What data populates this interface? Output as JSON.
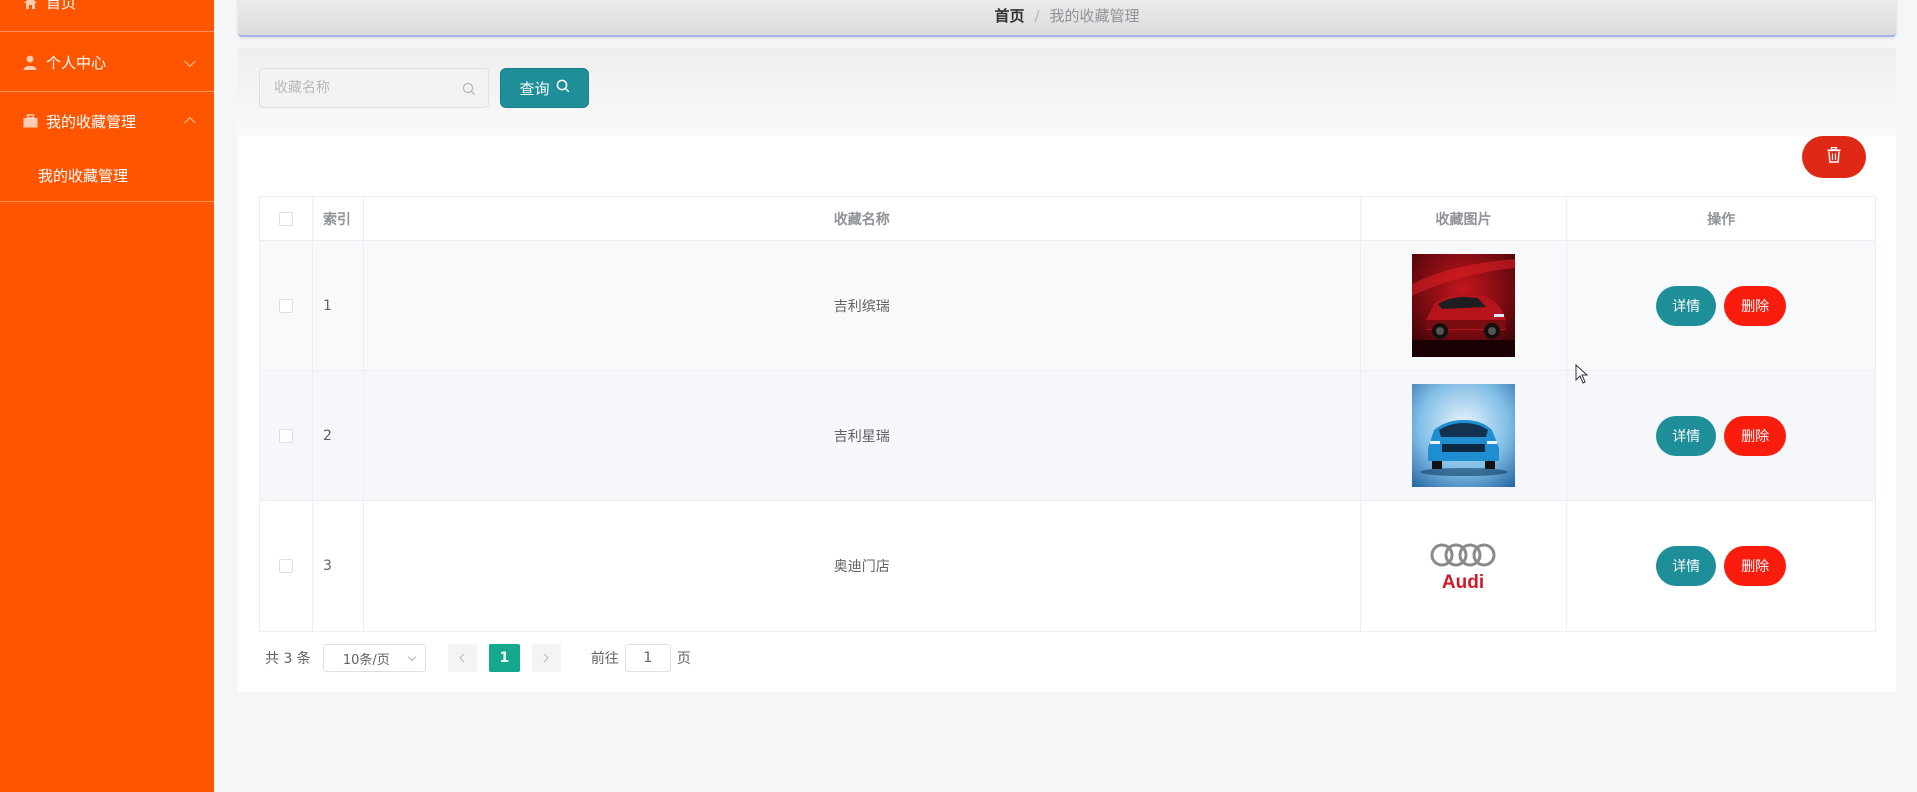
{
  "sidebar": {
    "items": [
      {
        "label": "首页",
        "icon": "home-icon"
      },
      {
        "label": "个人中心",
        "icon": "user-icon",
        "expanded": false
      },
      {
        "label": "我的收藏管理",
        "icon": "briefcase-icon",
        "expanded": true
      }
    ],
    "submenu": [
      {
        "label": "我的收藏管理"
      }
    ],
    "bg_color": "#ff5500"
  },
  "breadcrumb": {
    "home": "首页",
    "separator": "/",
    "current": "我的收藏管理"
  },
  "search": {
    "placeholder": "收藏名称",
    "value": "",
    "query_label": "查询"
  },
  "toolbar": {
    "bulk_delete_icon": "trash-icon"
  },
  "table": {
    "columns": [
      "索引",
      "收藏名称",
      "收藏图片",
      "操作"
    ],
    "rows": [
      {
        "index": "1",
        "name": "吉利缤瑞",
        "image": "red-car"
      },
      {
        "index": "2",
        "name": "吉利星瑞",
        "image": "blue-car"
      },
      {
        "index": "3",
        "name": "奥迪门店",
        "image": "audi-logo"
      }
    ],
    "detail_label": "详情",
    "delete_label": "删除"
  },
  "audi_text": "Audi",
  "pagination": {
    "total": "共 3 条",
    "page_size": "10条/页",
    "current_page": "1",
    "goto_prefix": "前往",
    "goto_value": "1",
    "goto_suffix": "页"
  },
  "colors": {
    "primary_teal": "#1e8e99",
    "danger_red": "#fa1c0c",
    "page_active": "#14a98e"
  }
}
